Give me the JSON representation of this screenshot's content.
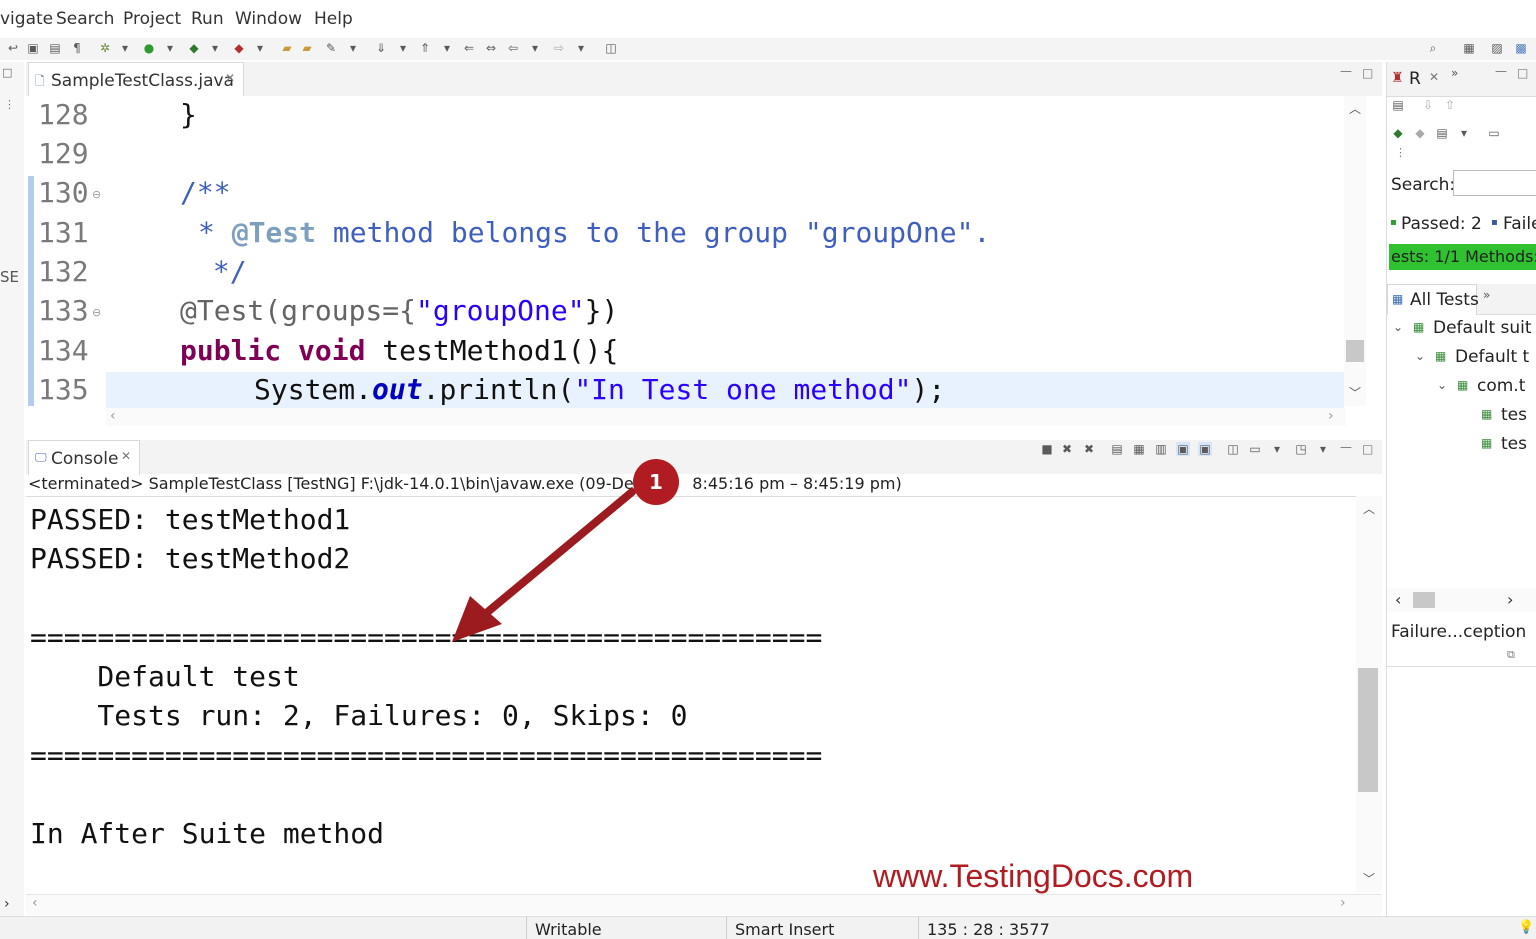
{
  "menubar": {
    "items": [
      "vigate",
      "Search",
      "Project",
      "Run",
      "Window",
      "Help"
    ]
  },
  "editor": {
    "tab_label": "SampleTestClass.java",
    "line_numbers": [
      "128",
      "129",
      "130",
      "131",
      "132",
      "133",
      "134",
      "135"
    ],
    "lines": {
      "l128": "}",
      "l130": "/**",
      "l131_star": "* ",
      "l131_tag": "@Test",
      "l131_rest": " method belongs to the group \"groupOne\".",
      "l132": " */",
      "l133_ann": "@Test(groups={",
      "l133_str": "\"groupOne\"",
      "l133_end": "})",
      "l134_kw1": "public",
      "l134_kw2": "void",
      "l134_rest": " testMethod1(){",
      "l135_a": "System.",
      "l135_out": "out",
      "l135_b": ".println(",
      "l135_str": "\"In Test one method\"",
      "l135_c": ");"
    }
  },
  "console": {
    "tab_label": "Console",
    "info": "<terminated> SampleTestClass [TestNG] F:\\jdk-14.0.1\\bin\\javaw.exe  (09-Dec-",
    "info_time": "8:45:16 pm – 8:45:19 pm)",
    "output": {
      "o1": "PASSED: testMethod1",
      "o2": "PASSED: testMethod2",
      "sep1": "===============================================",
      "o3": "    Default test",
      "o4": "    Tests run: 2, Failures: 0, Skips: 0",
      "sep2": "===============================================",
      "o5": "In After Suite method"
    }
  },
  "testng": {
    "tab_label": "R",
    "search_label": "Search:",
    "passed": "Passed: 2",
    "failed": "Faile",
    "progress_text": "ests: 1/1  Methods:",
    "all_tests": "All Tests",
    "tree": [
      "Default suit",
      "Default t",
      "com.t",
      "tes",
      "tes"
    ],
    "failure_label": "Failure...ception"
  },
  "statusbar": {
    "writable": "Writable",
    "insert_mode": "Smart Insert",
    "position": "135 : 28 : 3577"
  },
  "annotation": {
    "callout_number": "1",
    "watermark": "www.TestingDocs.com"
  },
  "misc": {
    "left_edge_label": "SE"
  },
  "colors": {
    "accent_red": "#b01c22",
    "progress_green": "#2fc12f",
    "keyword": "#7f0055",
    "comment": "#3f5fbf",
    "string": "#2a00ff"
  }
}
